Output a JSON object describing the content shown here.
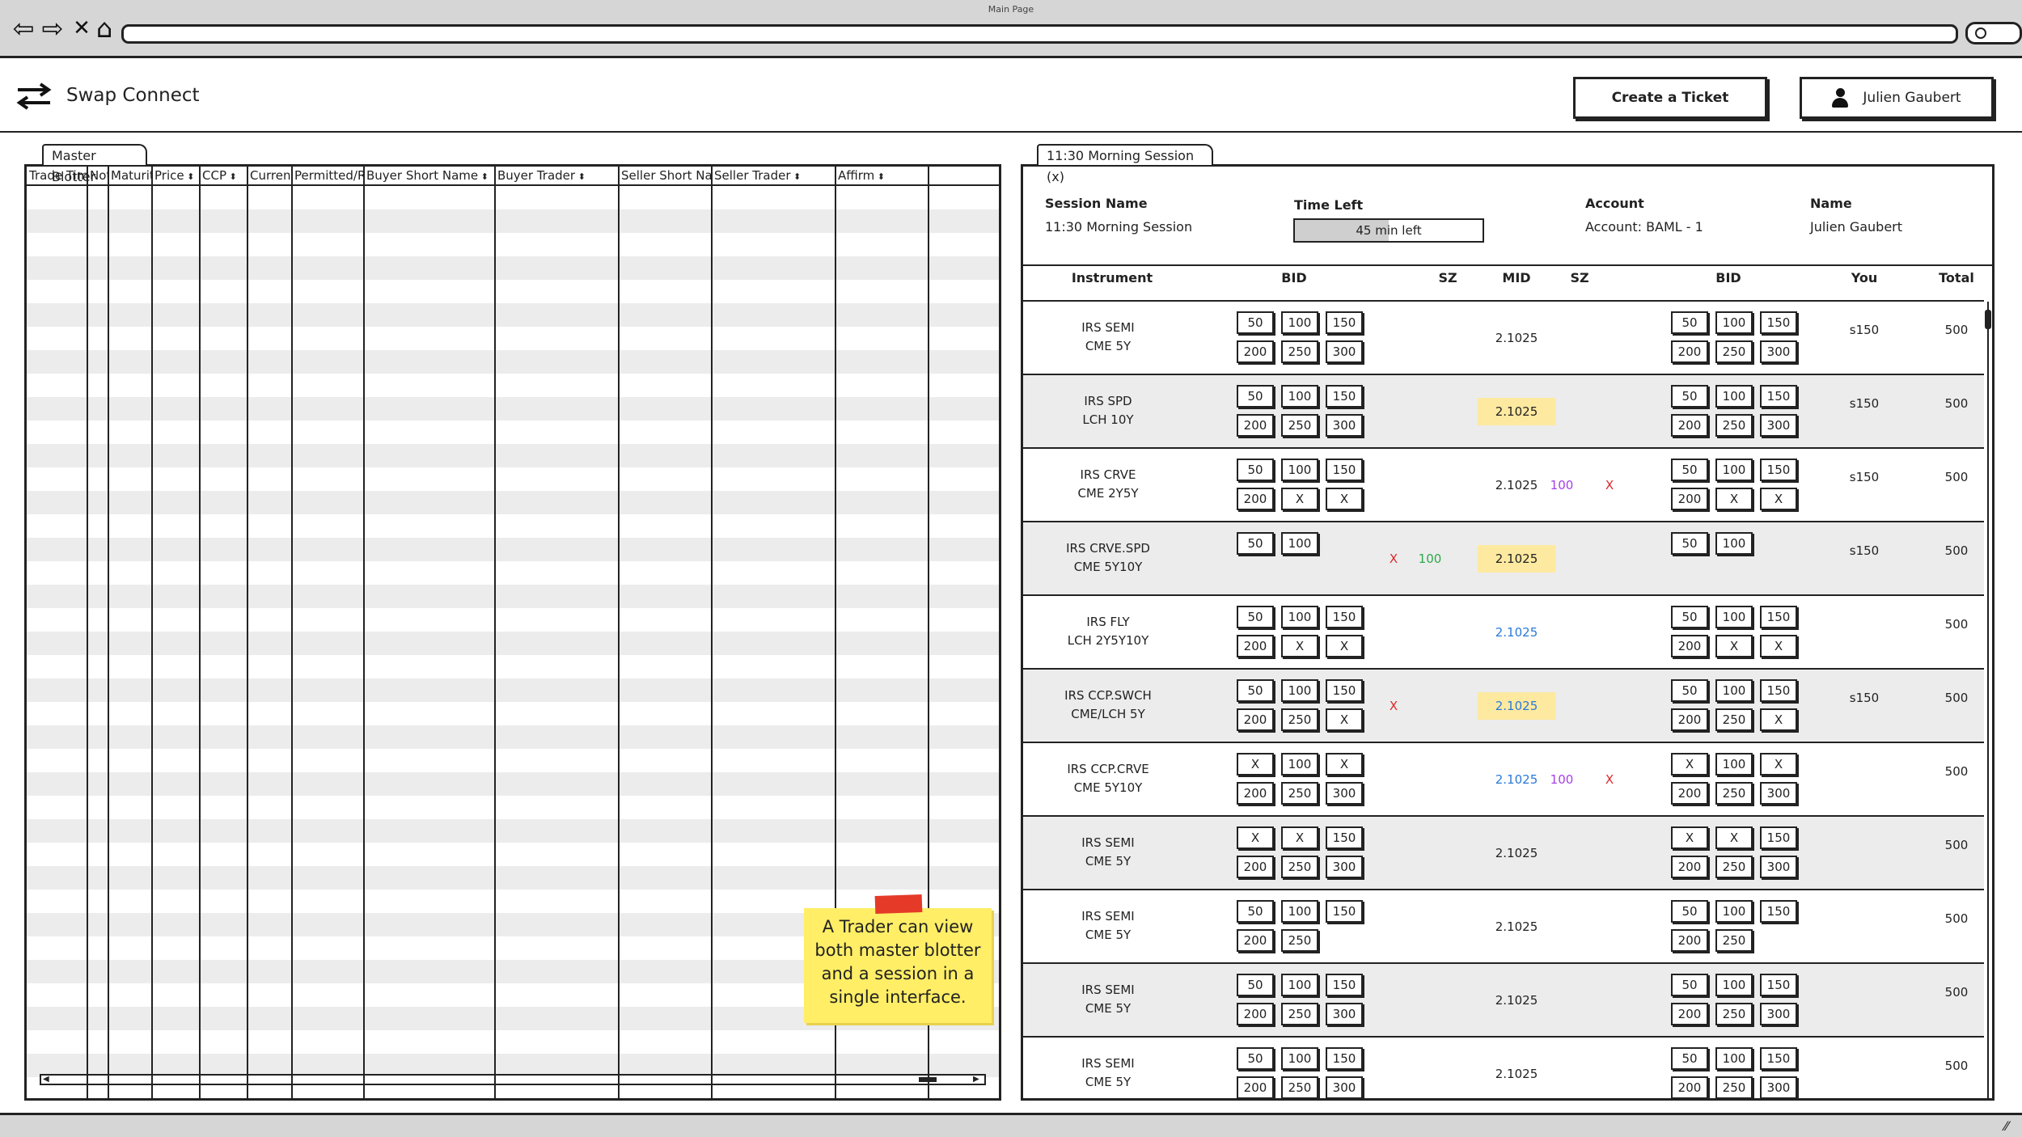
{
  "window": {
    "title": "Main Page"
  },
  "colors": {
    "highlight": "#fde9a0",
    "blue": "#2a7ad8",
    "purple": "#a640e6",
    "red": "#e0282a",
    "green": "#2fa84a",
    "note": "#ffee66",
    "tape": "#e53a28"
  },
  "app": {
    "title": "Swap Connect",
    "create_ticket_label": "Create a Ticket",
    "user_name": "Julien Gaubert"
  },
  "blotter": {
    "tab_label": "Master Blotter",
    "sort_icon": "sort-arrows-icon",
    "columns": [
      {
        "label": "Trade Time"
      },
      {
        "label": "Notional"
      },
      {
        "label": "Maturity"
      },
      {
        "label": "Price"
      },
      {
        "label": "CCP"
      },
      {
        "label": "Currency"
      },
      {
        "label": "Permitted/Required"
      },
      {
        "label": "Buyer Short Name"
      },
      {
        "label": "Buyer Trader"
      },
      {
        "label": "Seller Short Name"
      },
      {
        "label": "Seller Trader"
      },
      {
        "label": "Affirm"
      }
    ]
  },
  "note": {
    "text": "A Trader can view both master blotter and a session in a single interface."
  },
  "session": {
    "tab_label": "11:30 Morning Session (x)",
    "session_name_label": "Session Name",
    "session_name": "11:30 Morning Session",
    "time_left_label": "Time Left",
    "time_left": "45 min left",
    "time_left_fraction": 0.5,
    "account_label": "Account",
    "account": "Account: BAML - 1",
    "name_label": "Name",
    "name": "Julien Gaubert",
    "headers": {
      "instrument": "Instrument",
      "bid": "BID",
      "sz": "SZ",
      "mid": "MID",
      "sz2": "SZ",
      "bid2": "BID",
      "you": "You",
      "total": "Total"
    },
    "rows": [
      {
        "line1": "IRS  SEMI",
        "line2": "CME  5Y",
        "bid": [
          "50",
          "100",
          "150",
          "200",
          "250",
          "300"
        ],
        "bid2": [
          "50",
          "100",
          "150",
          "200",
          "250",
          "300"
        ],
        "mid": "2.1025",
        "mid_style": "",
        "sz_left": "",
        "sz_left_color": "",
        "sz_mid": "",
        "sz_mid_color": "",
        "sz_right": "",
        "sz_right_color": "",
        "you": "s150",
        "total": "500"
      },
      {
        "line1": "IRS  SPD",
        "line2": "LCH  10Y",
        "bid": [
          "50",
          "100",
          "150",
          "200",
          "250",
          "300"
        ],
        "bid2": [
          "50",
          "100",
          "150",
          "200",
          "250",
          "300"
        ],
        "mid": "2.1025",
        "mid_style": "hl",
        "sz_left": "",
        "sz_left_color": "",
        "sz_mid": "",
        "sz_mid_color": "",
        "sz_right": "",
        "sz_right_color": "",
        "you": "s150",
        "total": "500"
      },
      {
        "line1": "IRS  CRVE",
        "line2": "CME  2Y5Y",
        "bid": [
          "50",
          "100",
          "150",
          "200",
          "X",
          "X"
        ],
        "bid2": [
          "50",
          "100",
          "150",
          "200",
          "X",
          "X"
        ],
        "mid": "2.1025",
        "mid_style": "",
        "sz_left": "",
        "sz_left_color": "",
        "sz_mid": "",
        "sz_mid_color": "",
        "sz_right": "100",
        "sz_right_color": "#a640e6",
        "sz_far": "X",
        "sz_far_color": "#e0282a",
        "you": "s150",
        "total": "500"
      },
      {
        "line1": "IRS  CRVE.SPD",
        "line2": "CME  5Y10Y",
        "bid": [
          "50",
          "100"
        ],
        "bid2": [
          "50",
          "100"
        ],
        "mid": "2.1025",
        "mid_style": "hl",
        "sz_left": "X",
        "sz_left_color": "#e0282a",
        "sz_mid": "100",
        "sz_mid_color": "#2fa84a",
        "sz_right": "",
        "sz_right_color": "",
        "you": "s150",
        "total": "500"
      },
      {
        "line1": "IRS  FLY",
        "line2": "LCH  2Y5Y10Y",
        "bid": [
          "50",
          "100",
          "150",
          "200",
          "X",
          "X"
        ],
        "bid2": [
          "50",
          "100",
          "150",
          "200",
          "X",
          "X"
        ],
        "mid": "2.1025",
        "mid_style": "blue",
        "sz_left": "",
        "sz_left_color": "",
        "sz_mid": "",
        "sz_mid_color": "",
        "sz_right": "",
        "sz_right_color": "",
        "you": "",
        "total": "500"
      },
      {
        "line1": "IRS  CCP.SWCH",
        "line2": "CME/LCH  5Y",
        "bid": [
          "50",
          "100",
          "150",
          "200",
          "250",
          "X"
        ],
        "bid2": [
          "50",
          "100",
          "150",
          "200",
          "250",
          "X"
        ],
        "mid": "2.1025",
        "mid_style": "hl blue",
        "sz_left": "X",
        "sz_left_color": "#e0282a",
        "sz_mid": "",
        "sz_mid_color": "",
        "sz_right": "",
        "sz_right_color": "",
        "you": "s150",
        "total": "500"
      },
      {
        "line1": "IRS  CCP.CRVE",
        "line2": "CME  5Y10Y",
        "bid": [
          "X",
          "100",
          "X",
          "200",
          "250",
          "300"
        ],
        "bid2": [
          "X",
          "100",
          "X",
          "200",
          "250",
          "300"
        ],
        "mid": "2.1025",
        "mid_style": "blue",
        "sz_left": "",
        "sz_left_color": "",
        "sz_mid": "",
        "sz_mid_color": "",
        "sz_right": "100",
        "sz_right_color": "#a640e6",
        "sz_far": "X",
        "sz_far_color": "#e0282a",
        "you": "",
        "total": "500"
      },
      {
        "line1": "IRS  SEMI",
        "line2": "CME  5Y",
        "bid": [
          "X",
          "X",
          "150",
          "200",
          "250",
          "300"
        ],
        "bid2": [
          "X",
          "X",
          "150",
          "200",
          "250",
          "300"
        ],
        "mid": "2.1025",
        "mid_style": "",
        "sz_left": "",
        "sz_left_color": "",
        "sz_mid": "",
        "sz_mid_color": "",
        "sz_right": "",
        "sz_right_color": "",
        "you": "",
        "total": "500"
      },
      {
        "line1": "IRS  SEMI",
        "line2": "CME  5Y",
        "bid": [
          "50",
          "100",
          "150",
          "200",
          "250"
        ],
        "bid2": [
          "50",
          "100",
          "150",
          "200",
          "250"
        ],
        "mid": "2.1025",
        "mid_style": "",
        "sz_left": "",
        "sz_left_color": "",
        "sz_mid": "",
        "sz_mid_color": "",
        "sz_right": "",
        "sz_right_color": "",
        "you": "",
        "total": "500"
      },
      {
        "line1": "IRS  SEMI",
        "line2": "CME  5Y",
        "bid": [
          "50",
          "100",
          "150",
          "200",
          "250",
          "300"
        ],
        "bid2": [
          "50",
          "100",
          "150",
          "200",
          "250",
          "300"
        ],
        "mid": "2.1025",
        "mid_style": "",
        "sz_left": "",
        "sz_left_color": "",
        "sz_mid": "",
        "sz_mid_color": "",
        "sz_right": "",
        "sz_right_color": "",
        "you": "",
        "total": "500"
      },
      {
        "line1": "IRS  SEMI",
        "line2": "CME  5Y",
        "bid": [
          "50",
          "100",
          "150",
          "200",
          "250",
          "300"
        ],
        "bid2": [
          "50",
          "100",
          "150",
          "200",
          "250",
          "300"
        ],
        "mid": "2.1025",
        "mid_style": "",
        "sz_left": "",
        "sz_left_color": "",
        "sz_mid": "",
        "sz_mid_color": "",
        "sz_right": "",
        "sz_right_color": "",
        "you": "",
        "total": "500"
      }
    ]
  }
}
